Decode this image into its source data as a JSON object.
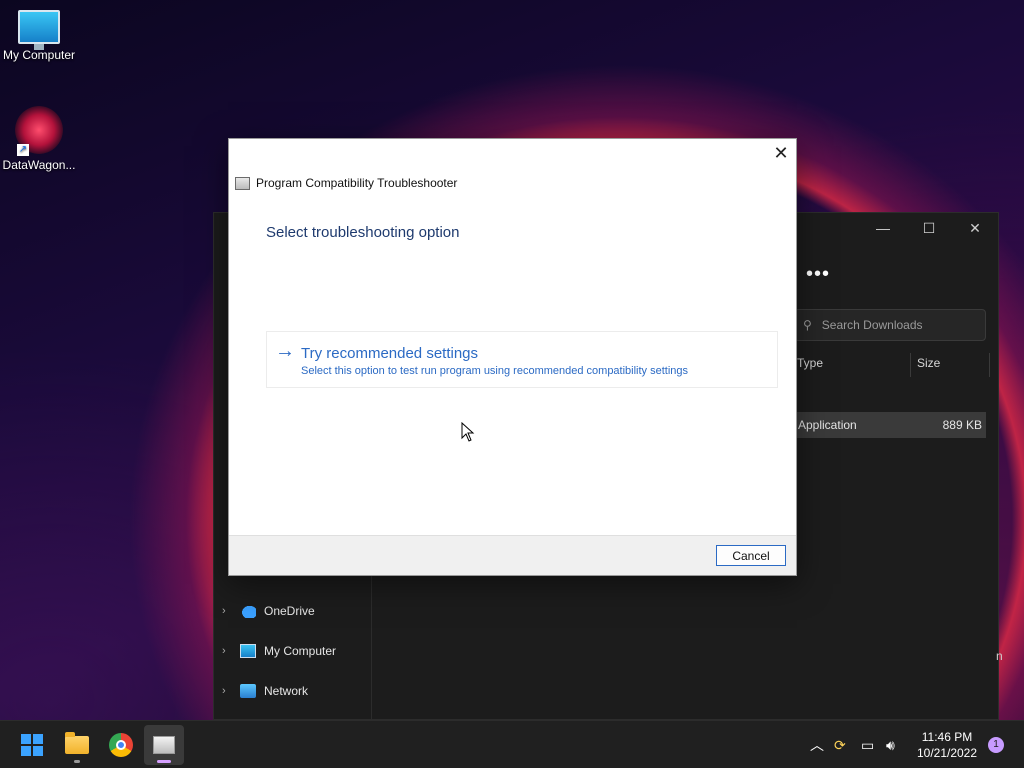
{
  "desktop": {
    "icons": [
      {
        "label": "My Computer",
        "icon": "monitor-icon"
      },
      {
        "label": "DataWagon...",
        "icon": "datawagon-icon"
      }
    ]
  },
  "explorer": {
    "more_label": "•••",
    "search_placeholder": "Search Downloads",
    "columns": {
      "type": "Type",
      "size": "Size"
    },
    "row": {
      "type": "Application",
      "size": "889 KB"
    },
    "nav": [
      {
        "label": "OneDrive",
        "icon": "onedrive-icon"
      },
      {
        "label": "My Computer",
        "icon": "monitor-icon"
      },
      {
        "label": "Network",
        "icon": "network-icon"
      }
    ],
    "partial_text": "n"
  },
  "dialog": {
    "title": "Program Compatibility Troubleshooter",
    "heading": "Select troubleshooting option",
    "option": {
      "title": "Try recommended settings",
      "description": "Select this option to test run program using recommended compatibility settings"
    },
    "cancel_label": "Cancel",
    "close_glyph": "✕"
  },
  "taskbar": {
    "apps": [
      "start",
      "file-explorer",
      "chrome",
      "program-compatibility-troubleshooter"
    ],
    "active_app": "program-compatibility-troubleshooter",
    "time": "11:46 PM",
    "date": "10/21/2022",
    "notifications": "1"
  },
  "colors": {
    "accent": "#2b6ac4",
    "heading": "#1e3a6e",
    "taskbar": "#202020"
  }
}
